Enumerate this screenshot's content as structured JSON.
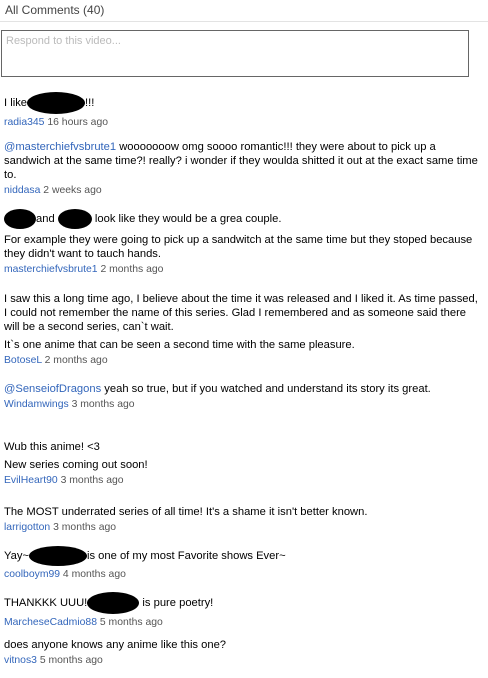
{
  "header": {
    "title": "All Comments (40)"
  },
  "respond": {
    "placeholder": "Respond to this video..."
  },
  "comments": [
    {
      "pre": "I like",
      "post": "!!!",
      "user": "radia345",
      "time": "16 hours ago"
    },
    {
      "mention": "@masterchiefvsbrute1",
      "text": " wooooooow omg soooo romantic!!! they were about to pick up a sandwich at the same time?! really? i wonder if they woulda shitted it out at the exact same time to.",
      "user": "niddasa",
      "time": "2 weeks ago"
    },
    {
      "mid": "and",
      "post": "look like they would be a grea couple.",
      "text": "For example they were going to pick up a sandwitch at the same time but they stoped because they didn't want to tauch hands.",
      "user": "masterchiefvsbrute1",
      "time": "2 months ago"
    },
    {
      "text": "I saw this a long time ago, I believe about the time it was released and I liked it. As time passed, I could not remember the name of this series. Glad I remembered and as someone said there will be a second series, can`t wait.",
      "text2": "It`s one anime that can be seen a second time with the same pleasure.",
      "user": "BotoseL",
      "time": "2 months ago"
    },
    {
      "mention": "@SenseiofDragons",
      "text": " yeah so true, but if you watched and understand its story its great.",
      "user": "Windamwings",
      "time": "3 months ago"
    },
    {
      "text": "Wub this anime! <3",
      "text2": "New series coming out soon!",
      "user": "EvilHeart90",
      "time": "3 months ago"
    },
    {
      "text": "The MOST underrated series of all time! It's a shame it isn't better known.",
      "user": "larrigotton",
      "time": "3 months ago"
    },
    {
      "pre": "Yay~",
      "post": "is one of my most Favorite shows Ever~",
      "user": "coolboym99",
      "time": "4 months ago"
    },
    {
      "pre": "THANKKK UUU!",
      "post": " is pure poetry!",
      "user": "MarcheseCadmio88",
      "time": "5 months ago"
    },
    {
      "text": "does anyone knows any anime like this one?",
      "user": "vitnos3",
      "time": "5 months ago"
    }
  ]
}
